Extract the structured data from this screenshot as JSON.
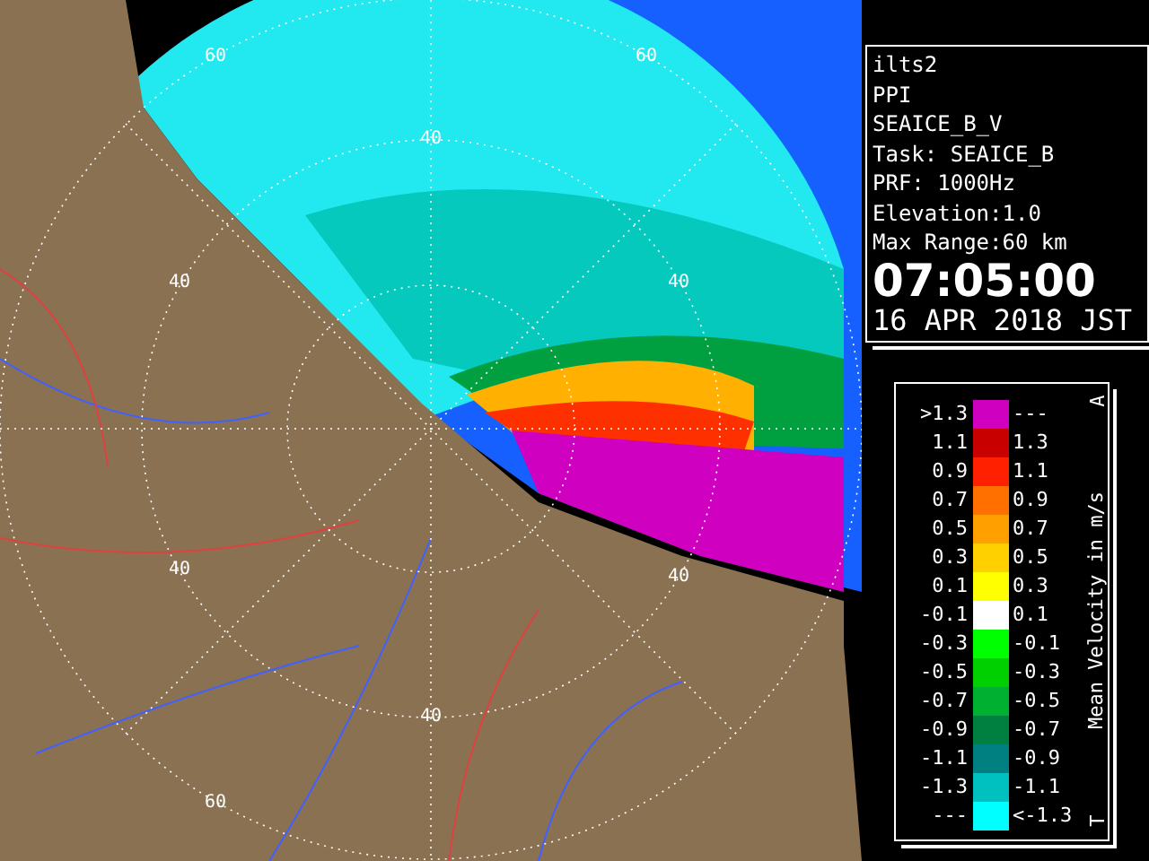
{
  "map": {
    "range_labels": [
      {
        "text": "60"
      },
      {
        "text": "60"
      },
      {
        "text": "40"
      },
      {
        "text": "40"
      },
      {
        "text": "40"
      },
      {
        "text": "40"
      },
      {
        "text": "40"
      },
      {
        "text": "40"
      },
      {
        "text": "60"
      }
    ]
  },
  "info": {
    "lines": [
      "ilts2",
      "PPI",
      "SEAICE_B_V",
      "Task: SEAICE_B",
      "PRF: 1000Hz",
      "Elevation:1.0",
      "Max Range:60 km"
    ],
    "time": "07:05:00",
    "date": "16 APR 2018 JST"
  },
  "legend": {
    "title": "Mean Velocity in m/s",
    "top_mark": "A",
    "bottom_mark": "T",
    "rows": [
      {
        "low": ">1.3",
        "high": "---",
        "color": "#d000c0"
      },
      {
        "low": "1.1",
        "high": "1.3",
        "color": "#c80000"
      },
      {
        "low": "0.9",
        "high": "1.1",
        "color": "#ff2000"
      },
      {
        "low": "0.7",
        "high": "0.9",
        "color": "#ff7000"
      },
      {
        "low": "0.5",
        "high": "0.7",
        "color": "#ffa000"
      },
      {
        "low": "0.3",
        "high": "0.5",
        "color": "#ffd000"
      },
      {
        "low": "0.1",
        "high": "0.3",
        "color": "#ffff00"
      },
      {
        "low": "-0.1",
        "high": "0.1",
        "color": "#ffffff"
      },
      {
        "low": "-0.3",
        "high": "-0.1",
        "color": "#00ff00"
      },
      {
        "low": "-0.5",
        "high": "-0.3",
        "color": "#00d000"
      },
      {
        "low": "-0.7",
        "high": "-0.5",
        "color": "#00b030"
      },
      {
        "low": "-0.9",
        "high": "-0.7",
        "color": "#008040"
      },
      {
        "low": "-1.1",
        "high": "-0.9",
        "color": "#008080"
      },
      {
        "low": "-1.3",
        "high": "-1.1",
        "color": "#00c0c0"
      },
      {
        "low": "---",
        "high": "<-1.3",
        "color": "#00ffff"
      }
    ]
  }
}
